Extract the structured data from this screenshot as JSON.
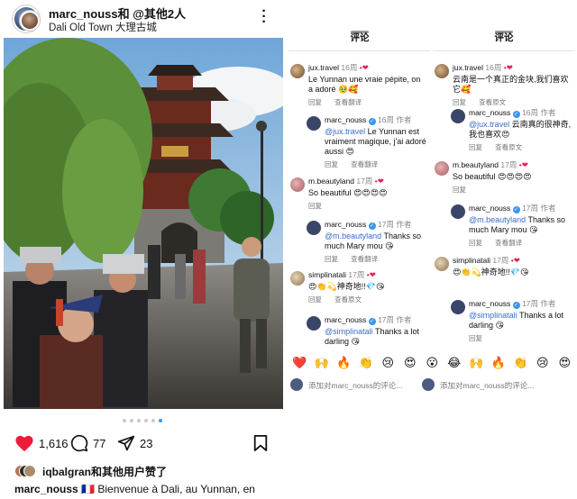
{
  "post": {
    "username": "marc_nouss和 @其他2人",
    "location": "Dali Old Town 大理古城",
    "more_icon": "more-vertical-icon",
    "carousel": {
      "count": 6,
      "active_index": 5
    },
    "likes_count": "1,616",
    "comments_count": "77",
    "shares_count": "23",
    "liked_by": "iqbalgran和其他用户赞了",
    "caption_user": "marc_nouss",
    "caption_flag": "🇫🇷",
    "caption_text": "Bienvenue à Dali, au Yunnan, en"
  },
  "comments_panel": {
    "title_left": "评论",
    "title_right": "评论",
    "reply_label": "回复",
    "see_translation": "查看翻译",
    "see_original": "查看原文",
    "author_tag": "作者",
    "left": [
      {
        "user": "jux.travel",
        "time": "16周",
        "text": "Le Yunnan une vraie pépite, on a adoré 🥹🥰"
      },
      {
        "user": "marc_nouss",
        "time": "16周",
        "mention": "@jux.travel",
        "text": " Le Yunnan est vraiment magique, j'ai adoré aussi 😍"
      },
      {
        "user": "m.beautyland",
        "time": "17周",
        "text": "So beautiful 😍😍😍😍"
      },
      {
        "user": "marc_nouss",
        "time": "17周",
        "mention": "@m.beautyland",
        "text": " Thanks so much Mary mou 😘"
      },
      {
        "user": "simplinatali",
        "time": "17周",
        "text": "😍👏💫神奇地!!💎😘"
      },
      {
        "user": "marc_nouss",
        "time": "17周",
        "mention": "@simplinatali",
        "text": " Thanks a lot darling 😘"
      }
    ],
    "right": [
      {
        "user": "jux.travel",
        "time": "16周",
        "text": "云南是一个真正的金块,我们喜欢它🥰"
      },
      {
        "user": "marc_nouss",
        "time": "16周",
        "mention": "@jux.travel",
        "text": " 云南真的很神奇,我也喜欢😍"
      },
      {
        "user": "m.beautyland",
        "time": "17周",
        "text": "So beautiful 😍😍😍😍"
      },
      {
        "user": "marc_nouss",
        "time": "17周",
        "mention": "@m.beautyland",
        "text": " Thanks so much Mary mou 😘"
      },
      {
        "user": "simplinatali",
        "time": "17周",
        "text": "😍👏💫神奇地!!💎😘"
      },
      {
        "user": "marc_nouss",
        "time": "17周",
        "mention": "@simplinatali",
        "text": " Thanks a lot darling 😘"
      }
    ],
    "emoji_bar": [
      "❤️",
      "🙌",
      "🔥",
      "👏",
      "😢",
      "😍",
      "😮",
      "😂",
      "🙌",
      "🔥",
      "👏",
      "😢",
      "😍"
    ],
    "input_placeholder": "添加对marc_nouss的评论..."
  }
}
